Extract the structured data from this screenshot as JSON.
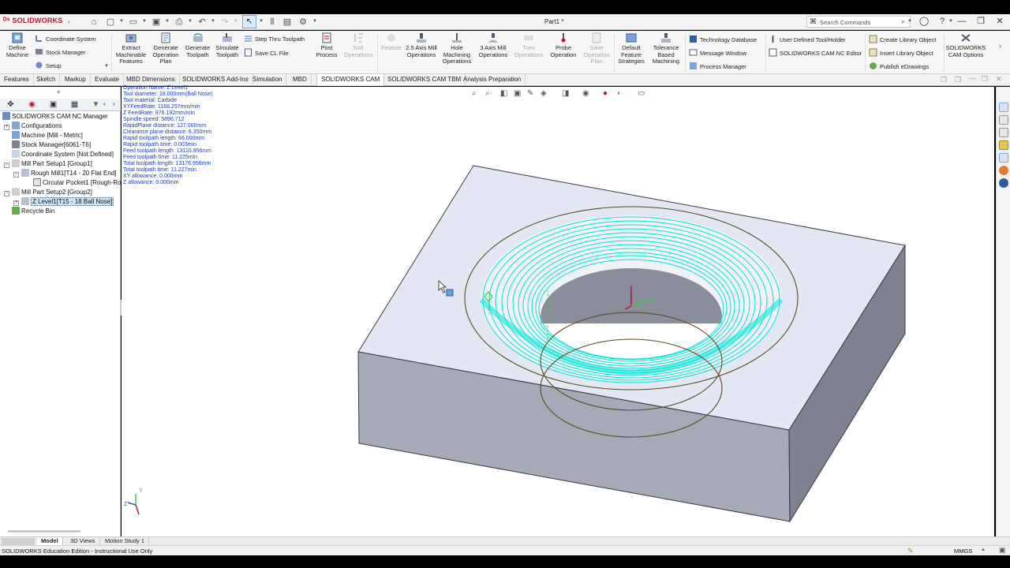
{
  "app": {
    "logo": "SOLIDWORKS",
    "doc_title": "Part1 *",
    "search_placeholder": "Search Commands"
  },
  "ribbon": {
    "define_machine": "Define Machine",
    "coordinate_system": "Coordinate System",
    "stock_manager": "Stock Manager",
    "setup": "Setup",
    "extract": "Extract Machinable Features",
    "gen_plan": "Generate Operation Plan",
    "gen_toolpath": "Generate Toolpath",
    "simulate": "Simulate Toolpath",
    "step_thru": "Step Thru Toolpath",
    "save_cl": "Save CL File",
    "post_process": "Post Process",
    "sort_ops": "Sort Operations",
    "feature": "Feature",
    "axis25": "2.5 Axis Mill Operations",
    "hole": "Hole Machining Operations",
    "axis3": "3 Axis Mill Operations",
    "turn": "Turn Operations",
    "probe": "Probe Operation",
    "save_op_plan": "Save Operation Plan",
    "default_feature": "Default Feature Strategies",
    "tolerance": "Tolerance Based Machining",
    "tech_db": "Technology Database",
    "message_window": "Message Window",
    "process_manager": "Process Manager",
    "user_tool": "User Defined Tool/Holder",
    "nc_editor": "SOLIDWORKS CAM NC Editor",
    "create_lib": "Create Library Object",
    "insert_lib": "Insert Library Object",
    "publish": "Publish eDrawings",
    "cam_options": "SOLIDWORKS CAM Options"
  },
  "tabs": [
    "Features",
    "Sketch",
    "Markup",
    "Evaluate",
    "MBD Dimensions",
    "SOLIDWORKS Add-Ins",
    "Simulation",
    "MBD",
    "SOLIDWORKS CAM",
    "SOLIDWORKS CAM TBM",
    "Analysis Preparation"
  ],
  "active_tab": "SOLIDWORKS CAM",
  "tree": {
    "root": "SOLIDWORKS CAM NC Manager",
    "configurations": "Configurations",
    "machine": "Machine [Mill - Metric]",
    "stock": "Stock Manager[6061-T6]",
    "coord": "Coordinate System [Not Defined]",
    "setup1": "Mill Part Setup1 [Group1]",
    "rough": "Rough Mill1[T14 - 20 Flat End]",
    "pocket": "Circular Pocket1 [Rough-Ro",
    "setup2": "Mill Part Setup2 [Group2]",
    "zlevel": "Z Level1[T15 - 18 Ball Nose]",
    "recycle": "Recycle Bin"
  },
  "operation_info": [
    "Operation Name: Z Level1",
    "Tool diameter: 18.000mm(Ball Nose)",
    "Tool material: Carbide",
    "XYFeedRate: 1168.257mm/min",
    "Z FeedRate: 876.192mm/min",
    "Spindle speed: 5896.712",
    "RapidPlane distance: 127.000mm",
    "Clearance plane distance: 6.350mm",
    "Rapid toolpath length: 66.000mm",
    "Rapid toolpath time: 0.003min",
    "Feed toolpath length: 13110.956mm",
    "Feed toolpath time: 11.225min",
    "Total toolpath length: 13176.956mm",
    "Total toolpath time: 11.227min",
    "XY allowance: 0.000mm",
    "Z allowance: 0.000mm"
  ],
  "bottom_tabs": [
    "Model",
    "3D Views",
    "Motion Study 1"
  ],
  "status": {
    "text": "SOLIDWORKS Education Edition - Instructional Use Only",
    "units": "MMGS"
  },
  "colors": {
    "toolpath": "#00e5d8",
    "part_top": "#e3e7f3",
    "part_front": "#a6a9b8",
    "part_right": "#7d8192",
    "brand": "#c8102e"
  }
}
